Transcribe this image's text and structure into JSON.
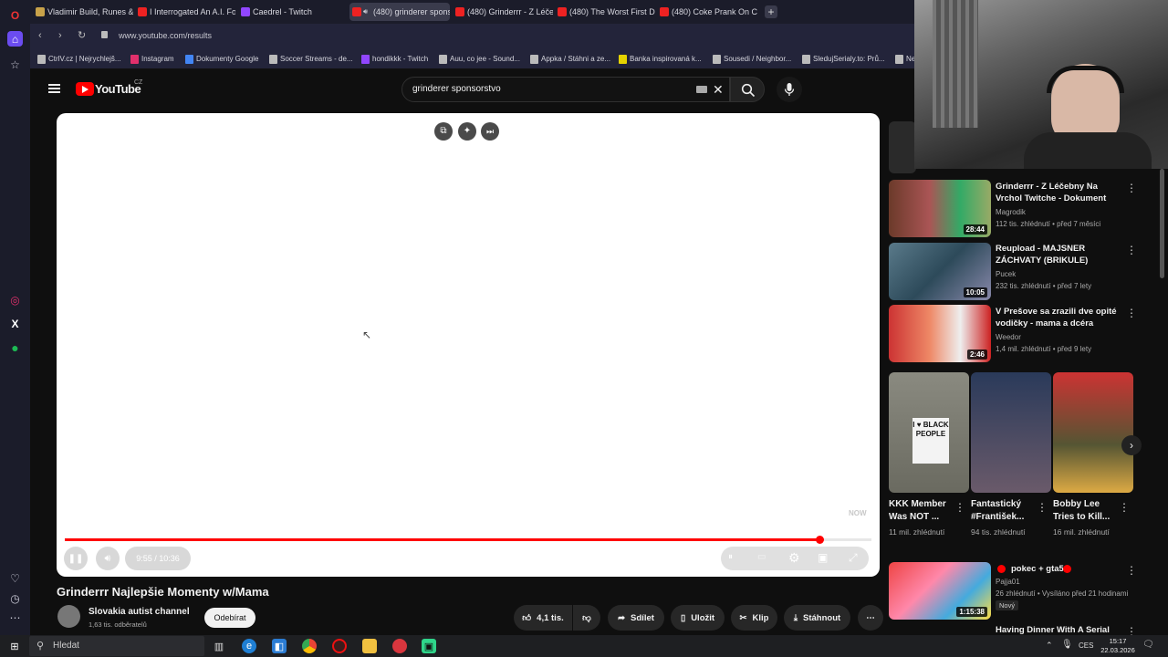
{
  "browser": {
    "tabs": [
      {
        "label": "Vladimir Build, Runes & C",
        "active": false
      },
      {
        "label": "I Interrogated An A.I. For",
        "active": false
      },
      {
        "label": "Caedrel - Twitch",
        "active": false
      },
      {
        "label": "(480) grinderer spons",
        "active": true
      },
      {
        "label": "(480) Grinderrr - Z Léčeb",
        "active": false
      },
      {
        "label": "(480) The Worst First Date",
        "active": false
      },
      {
        "label": "(480) Coke Prank On Cop",
        "active": false
      }
    ],
    "url": "www.youtube.com/results",
    "bookmarks": [
      "CtrlV.cz | Nejrychlejš...",
      "Instagram",
      "Dokumenty Google",
      "Soccer Streams - de...",
      "hondikkk - Twitch",
      "Auu, co jee - Sound...",
      "Appka / Stáhni a ze...",
      "Banka inspirovaná k...",
      "Sousedi / Neighbor...",
      "SledujSerialy.to: Prů...",
      "Ne"
    ]
  },
  "youtube": {
    "logo_text": "YouTube",
    "region": "CZ",
    "search_value": "grinderer sponsorstvo",
    "player": {
      "time": "9:55 / 10:36",
      "progress": 0.935,
      "watermark": "NOW"
    },
    "video_title": "Grinderrr Najlepšie Momenty w/Mama",
    "channel": {
      "name": "Slovakia autist channel",
      "subs": "1,63 tis. odběratelů",
      "subscribe_label": "Odebírat"
    },
    "actions": {
      "likes": "4,1 tis.",
      "share": "Sdílet",
      "save": "Uložit",
      "clip": "Klip",
      "download": "Stáhnout"
    },
    "recommendations": [
      {
        "title": "Grinderrr - Z Léčebny Na Vrchol Twitche - Dokument",
        "channel": "Magrodik",
        "meta": "112 tis. zhlédnutí • před 7 měsíci",
        "duration": "28:44"
      },
      {
        "title": "Reupload - MAJSNER ZÁCHVATY (BRIKULE)",
        "channel": "Pucek",
        "meta": "232 tis. zhlédnutí • před 7 lety",
        "duration": "10:05"
      },
      {
        "title": "V Prešove sa zrazili dve opité vodičky - mama a dcéra",
        "channel": "Weedor",
        "meta": "1,4 mil. zhlédnutí • před 9 lety",
        "duration": "2:46"
      }
    ],
    "shorts": [
      {
        "title": "KKK Member Was NOT ...",
        "views": "11 mil. zhlédnutí",
        "thumb_text": "I ♥ BLACK PEOPLE"
      },
      {
        "title": "Fantastický #František...",
        "views": "94 tis. zhlédnutí",
        "thumb_text": ""
      },
      {
        "title": "Bobby Lee Tries to Kill...",
        "views": "16 mil. zhlédnutí",
        "thumb_text": ""
      }
    ],
    "live_item": {
      "title": "pokec + gta5",
      "channel": "Pajja01",
      "meta": "26 zhlédnutí • Vysíláno před 21 hodinami",
      "badge": "Nový",
      "duration": "1:15:38"
    },
    "next_item_title": "Having Dinner With A Serial"
  },
  "taskbar": {
    "search_placeholder": "Hledat",
    "lang": "CES",
    "time": "15:17",
    "date": "22.03.2026"
  }
}
